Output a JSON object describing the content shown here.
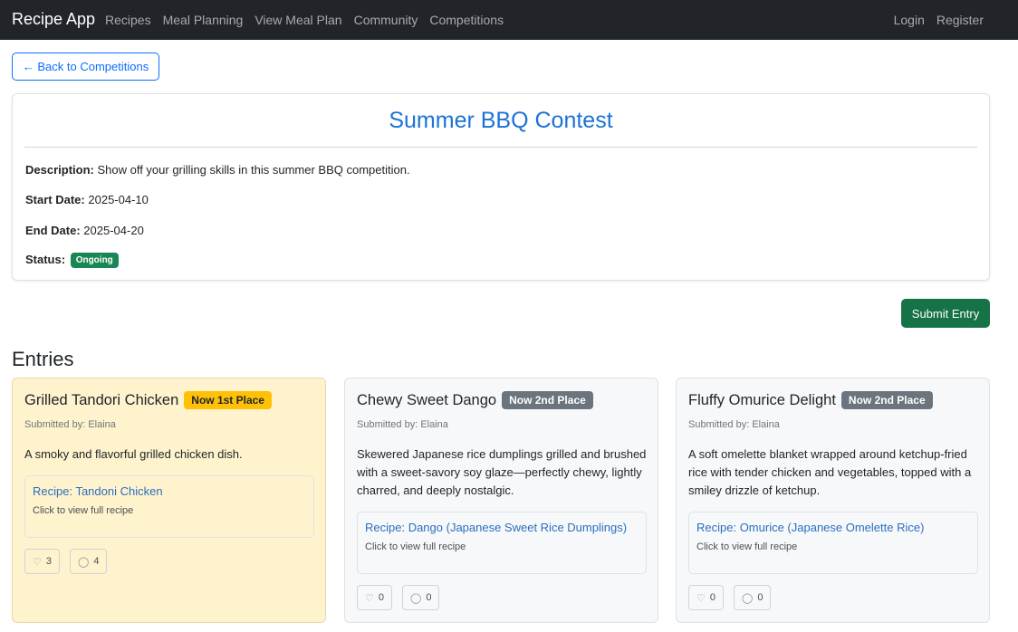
{
  "nav": {
    "brand": "Recipe App",
    "links": [
      "Recipes",
      "Meal Planning",
      "View Meal Plan",
      "Community",
      "Competitions"
    ],
    "login": "Login",
    "register": "Register"
  },
  "back_label": "← Back to Competitions",
  "competition": {
    "title": "Summer BBQ Contest",
    "description_label": "Description:",
    "description": "Show off your grilling skills in this summer BBQ competition.",
    "start_label": "Start Date:",
    "start_date": "2025-04-10",
    "end_label": "End Date:",
    "end_date": "2025-04-20",
    "status_label": "Status:",
    "status": "Ongoing"
  },
  "submit_label": "Submit Entry",
  "entries_heading": "Entries",
  "entries": [
    {
      "title": "Grilled Tandori Chicken",
      "badge": "Now 1st Place",
      "submitted": "Submitted by: Elaina",
      "description": "A smoky and flavorful grilled chicken dish.",
      "recipe": "Recipe: Tandoni Chicken",
      "recipe_sub": "Click to view full recipe",
      "likes": "3",
      "comments": "4"
    },
    {
      "title": "Chewy Sweet Dango",
      "badge": "Now 2nd Place",
      "submitted": "Submitted by: Elaina",
      "description": "Skewered Japanese rice dumplings grilled and brushed with a sweet-savory soy glaze—perfectly chewy, lightly charred, and deeply nostalgic.",
      "recipe": "Recipe: Dango (Japanese Sweet Rice Dumplings)",
      "recipe_sub": "Click to view full recipe",
      "likes": "0",
      "comments": "0"
    },
    {
      "title": "Fluffy Omurice Delight",
      "badge": "Now 2nd Place",
      "submitted": "Submitted by: Elaina",
      "description": "A soft omelette blanket wrapped around ketchup-fried rice with tender chicken and vegetables, topped with a smiley drizzle of ketchup.",
      "recipe": "Recipe: Omurice (Japanese Omelette Rice)",
      "recipe_sub": "Click to view full recipe",
      "likes": "0",
      "comments": "0"
    }
  ],
  "icons": {
    "like": "heart-icon",
    "comment": "comment-icon"
  },
  "colors": {
    "accent": "#0d6efd",
    "success": "#198754",
    "gold": "#ffc107",
    "secondary": "#6c757d",
    "highlight_bg": "#fff3cd"
  }
}
